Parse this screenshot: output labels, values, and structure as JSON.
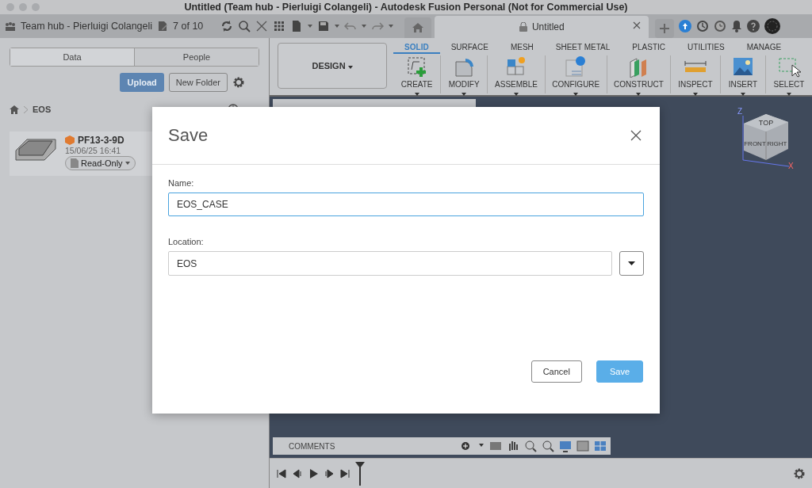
{
  "window": {
    "title": "Untitled (Team hub - Pierluigi Colangeli) - Autodesk Fusion Personal (Not for Commercial Use)"
  },
  "toolbar": {
    "hub": "Team hub - Pierluigi Colangeli",
    "count": "7 of 10"
  },
  "document_tabs": [
    {
      "label": "Untitled",
      "selected": true
    }
  ],
  "data_panel": {
    "tabs": [
      {
        "label": "Data",
        "selected": true
      },
      {
        "label": "People",
        "selected": false
      }
    ],
    "upload": "Upload",
    "new_folder": "New Folder",
    "breadcrumb": [
      "EOS"
    ],
    "files": [
      {
        "name": "PF13-3-9D",
        "date": "15/06/25 16:41",
        "access": "Read-Only"
      }
    ]
  },
  "workspace": "DESIGN",
  "ribbon_tabs": [
    {
      "label": "SOLID",
      "selected": true
    },
    {
      "label": "SURFACE",
      "selected": false
    },
    {
      "label": "MESH",
      "selected": false
    },
    {
      "label": "SHEET METAL",
      "selected": false
    },
    {
      "label": "PLASTIC",
      "selected": false
    },
    {
      "label": "UTILITIES",
      "selected": false
    },
    {
      "label": "MANAGE",
      "selected": false
    }
  ],
  "ribbon_groups": [
    {
      "label": "CREATE",
      "kind": "create"
    },
    {
      "label": "MODIFY",
      "kind": "modify"
    },
    {
      "label": "ASSEMBLE",
      "kind": "assemble"
    },
    {
      "label": "CONFIGURE",
      "kind": "configure"
    },
    {
      "label": "CONSTRUCT",
      "kind": "construct"
    },
    {
      "label": "INSPECT",
      "kind": "inspect"
    },
    {
      "label": "INSERT",
      "kind": "insert"
    },
    {
      "label": "SELECT",
      "kind": "select"
    }
  ],
  "view_cube": {
    "faces": [
      "TOP",
      "FRONT",
      "RIGHT"
    ],
    "axes": [
      "Z",
      "X"
    ]
  },
  "comments": "COMMENTS",
  "dialog": {
    "title": "Save",
    "name_label": "Name:",
    "name_value": "EOS_CASE",
    "location_label": "Location:",
    "location_value": "EOS",
    "buttons": [
      {
        "label": "Cancel",
        "kind": "secondary"
      },
      {
        "label": "Save",
        "kind": "primary"
      }
    ]
  }
}
